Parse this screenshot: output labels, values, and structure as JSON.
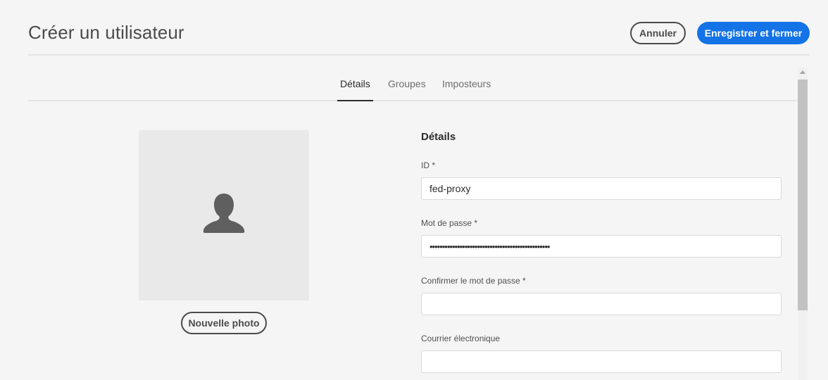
{
  "header": {
    "title": "Créer un utilisateur",
    "cancel_label": "Annuler",
    "save_label": "Enregistrer et fermer"
  },
  "tabs": [
    {
      "label": "Détails",
      "active": true
    },
    {
      "label": "Groupes",
      "active": false
    },
    {
      "label": "Imposteurs",
      "active": false
    }
  ],
  "photo": {
    "icon": "user-silhouette-icon",
    "button_label": "Nouvelle photo"
  },
  "form": {
    "section_title": "Détails",
    "fields": [
      {
        "label": "ID *",
        "value": "fed-proxy",
        "type": "text"
      },
      {
        "label": "Mot de passe *",
        "value": "••••••••••••••••••••••••••••••••••••••••••••••••",
        "type": "password"
      },
      {
        "label": "Confirmer le mot de passe *",
        "value": "",
        "type": "password"
      },
      {
        "label": "Courrier électronique",
        "value": "",
        "type": "text"
      }
    ]
  },
  "colors": {
    "accent": "#1473e6",
    "background": "#f5f5f5",
    "photo_placeholder": "#e9e9e9",
    "icon": "#5f5f5f"
  }
}
